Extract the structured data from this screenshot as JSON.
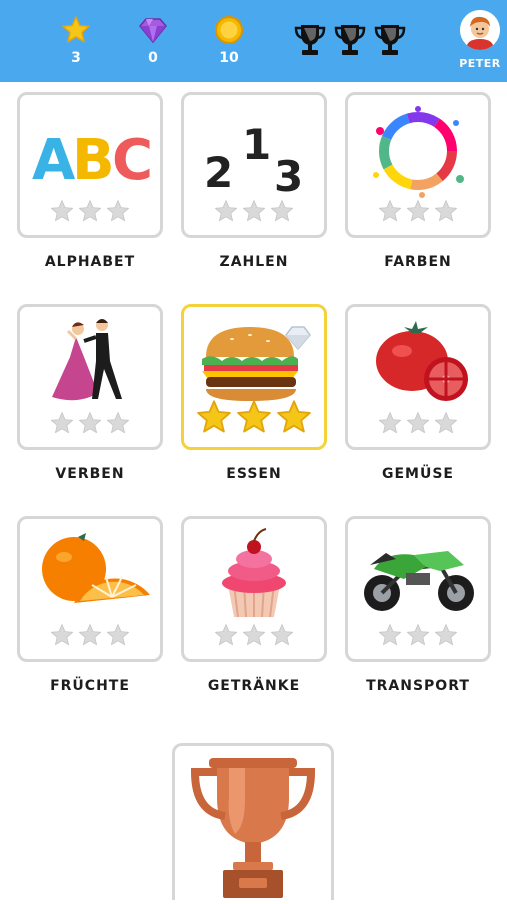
{
  "header": {
    "stars": "3",
    "diamonds": "0",
    "coins": "10",
    "profile_name": "PETER"
  },
  "categories": [
    {
      "label": "ALPHABET",
      "stars": 0
    },
    {
      "label": "ZAHLEN",
      "stars": 0
    },
    {
      "label": "FARBEN",
      "stars": 0
    },
    {
      "label": "VERBEN",
      "stars": 0
    },
    {
      "label": "ESSEN",
      "stars": 3
    },
    {
      "label": "GEMÜSE",
      "stars": 0
    },
    {
      "label": "FRÜCHTE",
      "stars": 0
    },
    {
      "label": "GETRÄNKE",
      "stars": 0
    },
    {
      "label": "TRANSPORT",
      "stars": 0
    }
  ],
  "tile_art": {
    "alphabet": "ABC",
    "zahlen": [
      "2",
      "1",
      "3"
    ]
  },
  "colors": {
    "header": "#4aa9ee",
    "star_gold": "#f5c518",
    "star_empty": "#d9d9d9",
    "active_border": "#f3d23c"
  }
}
